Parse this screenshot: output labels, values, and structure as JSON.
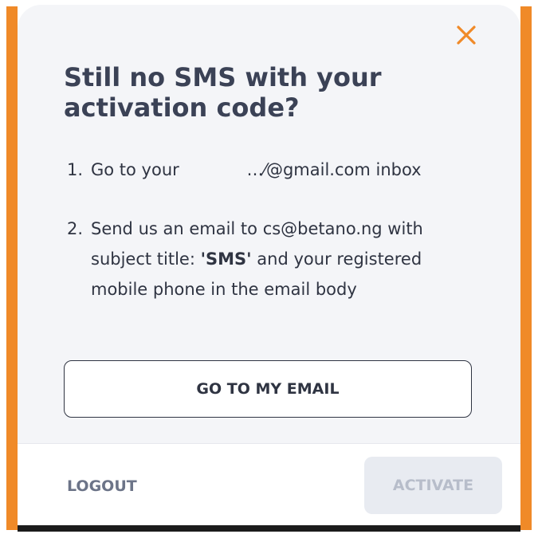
{
  "dialog": {
    "title": "Still no SMS with your activation code?",
    "close_icon": "close-icon",
    "steps": [
      {
        "number": "1.",
        "text_before": "Go to your ",
        "text_after": "…⁄@gmail.com inbox"
      },
      {
        "number": "2.",
        "text_before": "Send us an email to cs@betano.ng with subject title: ",
        "emphasis": "'SMS'",
        "text_after": " and your registered mobile phone in the email body"
      }
    ],
    "go_to_email_label": "GO TO MY EMAIL"
  },
  "footer": {
    "logout_label": "LOGOUT",
    "activate_label": "ACTIVATE"
  },
  "colors": {
    "accent": "#f08a28",
    "title": "#3b4256",
    "text": "#2f3442",
    "muted": "#6c7488",
    "disabled_bg": "#e8ebf1",
    "disabled_text": "#b7bdca"
  }
}
